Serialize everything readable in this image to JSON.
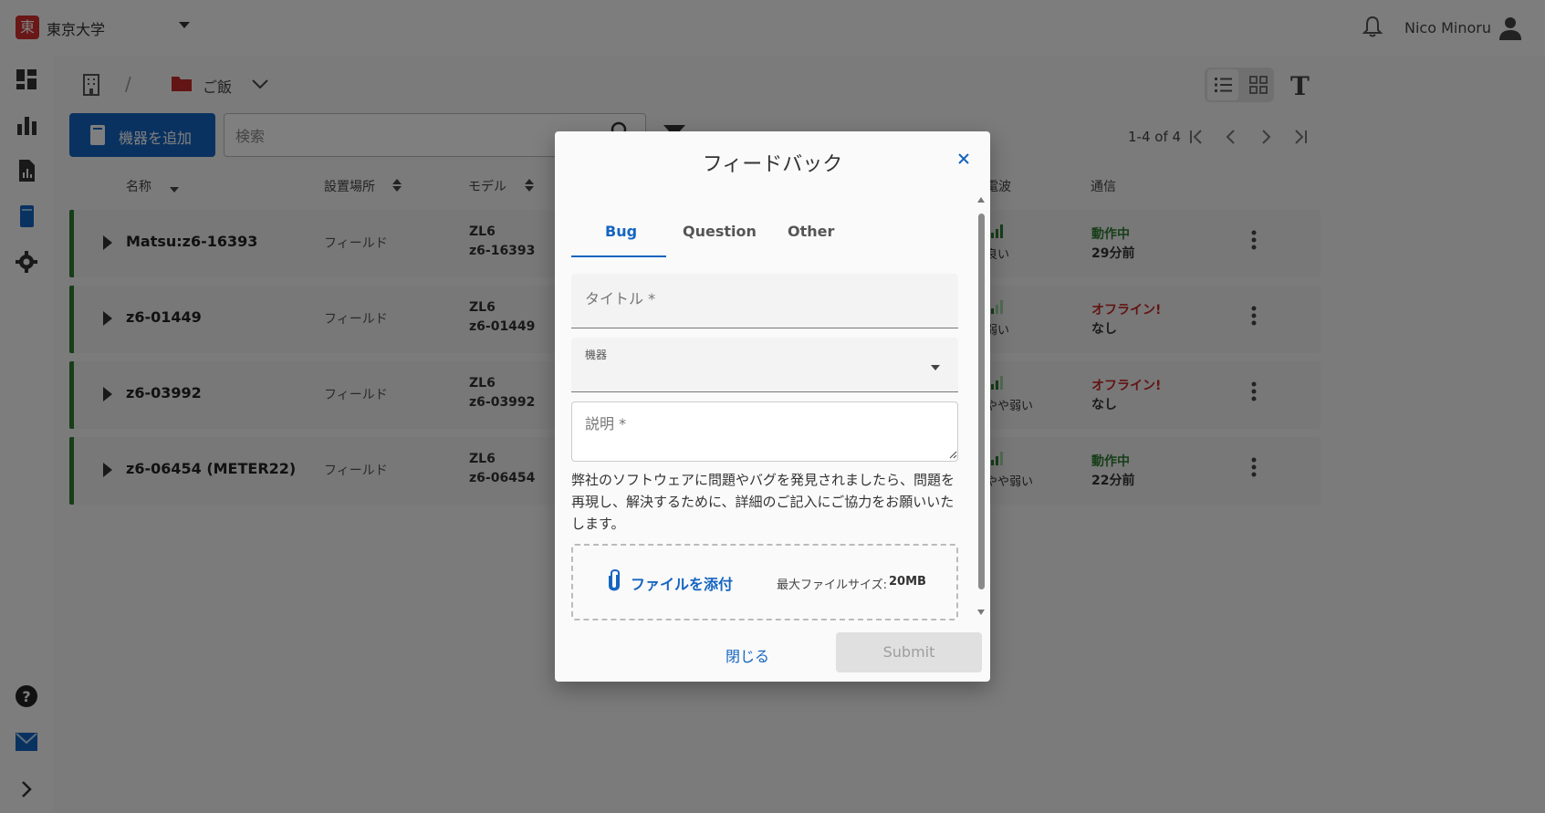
{
  "header": {
    "logo_char": "東",
    "org_name": "東京大学",
    "user_name": "Nico Minoru"
  },
  "breadcrumb": {
    "separator": "/",
    "folder_label": "ご飯"
  },
  "toolbar": {
    "add_button_label": "機器を追加",
    "search_placeholder": "検索",
    "pagination_text": "1-4 of 4",
    "text_size_glyph": "T"
  },
  "table": {
    "headers": {
      "name": "名称",
      "location": "設置場所",
      "model": "モデル",
      "signal": "電波",
      "comm": "通信"
    },
    "rows": [
      {
        "name": "Matsu:z6-16393",
        "location": "フィールド",
        "model_line1": "ZL6",
        "model_line2": "z6-16393",
        "signal": "良い",
        "status": "動作中",
        "status_color": "#2e7d32",
        "last_seen": "29分前"
      },
      {
        "name": "z6-01449",
        "location": "フィールド",
        "model_line1": "ZL6",
        "model_line2": "z6-01449",
        "signal": "弱い",
        "status": "オフライン!",
        "status_color": "#c62828",
        "last_seen": "なし"
      },
      {
        "name": "z6-03992",
        "location": "フィールド",
        "model_line1": "ZL6",
        "model_line2": "z6-03992",
        "signal": "やや弱い",
        "status": "オフライン!",
        "status_color": "#c62828",
        "last_seen": "なし"
      },
      {
        "name": "z6-06454 (METER22)",
        "location": "フィールド",
        "model_line1": "ZL6",
        "model_line2": "z6-06454",
        "signal": "やや弱い",
        "status": "動作中",
        "status_color": "#2e7d32",
        "last_seen": "22分前"
      }
    ]
  },
  "dialog": {
    "title": "フィードバック",
    "tabs": [
      "Bug",
      "Question",
      "Other"
    ],
    "active_tab": "Bug",
    "title_placeholder": "タイトル *",
    "device_label": "機器",
    "description_placeholder": "説明 *",
    "help_text": "弊社のソフトウェアに問題やバグを発見されましたら、問題を再現し、解決するために、詳細のご記入にご協力をお願いいたします。",
    "attach_label": "ファイルを添付",
    "max_size_label": "最大ファイルサイズ:",
    "max_size_value": "20MB",
    "close_label": "閉じる",
    "submit_label": "Submit"
  },
  "colors": {
    "primary": "#1565c0",
    "online": "#2e7d32",
    "offline": "#c62828",
    "brand": "#d32f2f"
  },
  "icons": [
    "bell-icon",
    "user-icon",
    "dashboard-icon",
    "chart-icon",
    "report-icon",
    "device-icon",
    "settings-icon",
    "help-icon",
    "mail-icon",
    "expand-sidebar-icon",
    "building-icon",
    "folder-icon",
    "search-icon",
    "filter-icon",
    "list-view-icon",
    "grid-view-icon",
    "paperclip-icon",
    "close-icon"
  ]
}
